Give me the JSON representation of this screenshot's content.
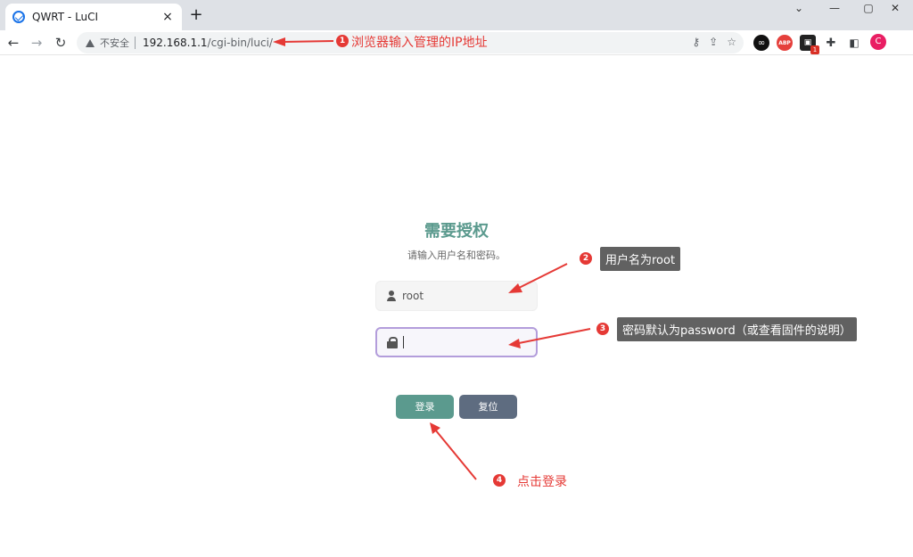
{
  "browser": {
    "tab_title": "QWRT - LuCI",
    "new_tab": "+",
    "close": "×",
    "window_controls": [
      "⌄",
      "—",
      "▢",
      "✕"
    ],
    "insecure_label": "不安全",
    "url_host": "192.168.1.1",
    "url_path": "/cgi-bin/luci/",
    "profile_initial": "C",
    "ext_badge": "1"
  },
  "login": {
    "title": "需要授权",
    "subtitle": "请输入用户名和密码。",
    "username_value": "root",
    "login_button": "登录",
    "reset_button": "复位"
  },
  "annotations": {
    "step1": {
      "num": "1",
      "text": "浏览器输入管理的IP地址"
    },
    "step2": {
      "num": "2",
      "text": "用户名为root"
    },
    "step3": {
      "num": "3",
      "text": "密码默认为password（或查看固件的说明）"
    },
    "step4": {
      "num": "4",
      "text": "点击登录"
    }
  },
  "colors": {
    "accent": "#5b9a8e",
    "reset": "#5e6c80",
    "annotation": "#e53935"
  }
}
